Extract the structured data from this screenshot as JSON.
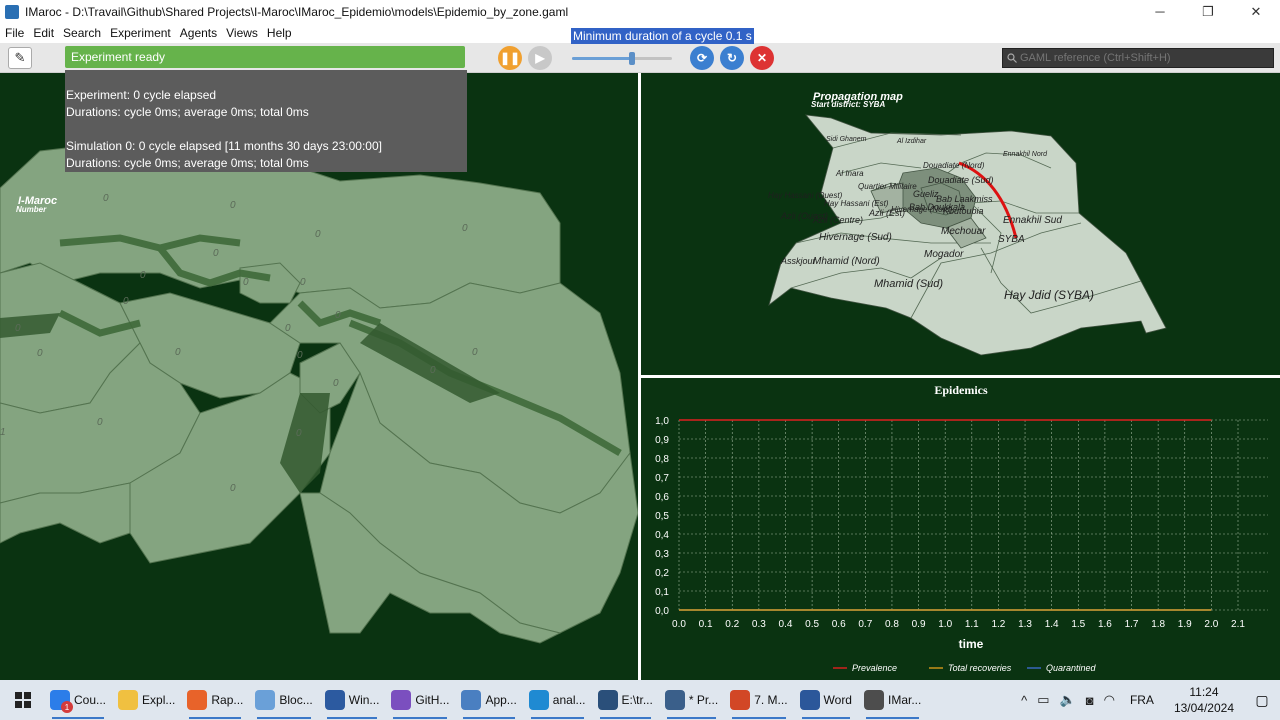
{
  "window": {
    "title": "IMaroc - D:\\Travail\\Github\\Shared Projects\\I-Maroc\\IMaroc_Epidemio\\models\\Epidemio_by_zone.gaml",
    "minimize": "─",
    "restore": "❐",
    "close": "✕"
  },
  "menu": [
    "File",
    "Edit",
    "Search",
    "Experiment",
    "Agents",
    "Views",
    "Help"
  ],
  "toolbar": {
    "status": "Experiment ready",
    "tooltip": "Minimum duration of a cycle 0.1 s",
    "slider_fraction": 0.6,
    "search_placeholder": "GAML reference (Ctrl+Shift+H)"
  },
  "info": {
    "experiment": "Experiment: 0 cycle elapsed",
    "exp_durations": "Durations: cycle 0ms; average 0ms; total 0ms",
    "simulation": "Simulation 0: 0 cycle elapsed [11 months 30 days 23:00:00]",
    "sim_durations": "Durations: cycle 0ms; average 0ms; total 0ms"
  },
  "left_view": {
    "title": "I-Maroc",
    "subtitle": "Number",
    "zone_values": [
      "0",
      "0",
      "0",
      "0",
      "0",
      "0",
      "0",
      "0",
      "0",
      "0",
      "0",
      "0",
      "0",
      "0",
      "0",
      "0",
      "0",
      "0",
      "1",
      "0",
      "0",
      "0"
    ]
  },
  "map": {
    "title": "Propagation map",
    "subtitle": "Start district: SYBA",
    "districts": [
      "Sidi Ghanem",
      "Al Izdihar",
      "Ennakhil Nord",
      "Douadiate (Nord)",
      "Al Inara",
      "Quartier Militaire",
      "Douadiate (Sud)",
      "Hay Hassani (Ouest)",
      "Hay Hassani (Est)",
      "Gueliz",
      "Bab Laakmiss",
      "Bab Doukkala",
      "Azli (Ouest)",
      "Azli (Est)",
      "Hivernage (Nord)",
      "Koutoubia",
      "Azli (Centre)",
      "Ennakhil Sud",
      "Hivernage (Sud)",
      "Mechouar",
      "SYBA",
      "Asskjour",
      "Mhamid (Nord)",
      "Mogador",
      "Mhamid (Sud)",
      "Hay Jdid (SYBA)"
    ]
  },
  "chart_data": {
    "type": "line",
    "title": "Epidemics",
    "xlabel": "time",
    "ylabel": "",
    "x_ticks": [
      "0.0",
      "0.1",
      "0.2",
      "0.3",
      "0.4",
      "0.5",
      "0.6",
      "0.7",
      "0.8",
      "0.9",
      "1.0",
      "1.1",
      "1.2",
      "1.3",
      "1.4",
      "1.5",
      "1.6",
      "1.7",
      "1.8",
      "1.9",
      "2.0",
      "2.1"
    ],
    "y_ticks": [
      "0,0",
      "0,1",
      "0,2",
      "0,3",
      "0,4",
      "0,5",
      "0,6",
      "0,7",
      "0,8",
      "0,9",
      "1,0"
    ],
    "xlim": [
      0,
      2.1
    ],
    "ylim": [
      0,
      1
    ],
    "grid": true,
    "legend_position": "bottom-right",
    "series": [
      {
        "name": "Prevalence",
        "color": "#e02020",
        "x": [
          0,
          2.0
        ],
        "y": [
          1,
          1
        ]
      },
      {
        "name": "Total recoveries",
        "color": "#d49a1a",
        "x": [
          0,
          2.0
        ],
        "y": [
          0,
          0
        ]
      },
      {
        "name": "Quarantined",
        "color": "#3b6bc8",
        "x": [
          0,
          2.0
        ],
        "y": [
          0,
          0
        ]
      }
    ]
  },
  "taskbar": {
    "items": [
      {
        "label": "Cou...",
        "icon": "chrome-icon",
        "color": "#2b7de9",
        "badge": "1",
        "active": true
      },
      {
        "label": "Expl...",
        "icon": "folder-icon",
        "color": "#f0c040",
        "active": false
      },
      {
        "label": "Rap...",
        "icon": "firefox-icon",
        "color": "#e8632a",
        "active": true
      },
      {
        "label": "Bloc...",
        "icon": "notepad-icon",
        "color": "#6aa0d8",
        "active": true
      },
      {
        "label": "Win...",
        "icon": "powershell-icon",
        "color": "#2c5aa0",
        "active": true
      },
      {
        "label": "GitH...",
        "icon": "github-icon",
        "color": "#7b4fbf",
        "active": true
      },
      {
        "label": "App...",
        "icon": "pdf-icon",
        "color": "#4a7fc1",
        "active": true
      },
      {
        "label": "anal...",
        "icon": "vscode-icon",
        "color": "#1f8ad2",
        "active": true
      },
      {
        "label": "E:\\tr...",
        "icon": "gama-icon",
        "color": "#2a4f7a",
        "active": true
      },
      {
        "label": "* Pr...",
        "icon": "gama2-icon",
        "color": "#3a5f8a",
        "active": true
      },
      {
        "label": "7. M...",
        "icon": "powerpoint-icon",
        "color": "#d24726",
        "active": true
      },
      {
        "label": "Word",
        "icon": "word-icon",
        "color": "#2b579a",
        "active": true
      },
      {
        "label": "IMar...",
        "icon": "gama3-icon",
        "color": "#4d4d4d",
        "active": true
      }
    ],
    "tray": {
      "chevron": "^",
      "lang": "FRA",
      "time": "11:24",
      "date": "13/04/2024"
    }
  }
}
